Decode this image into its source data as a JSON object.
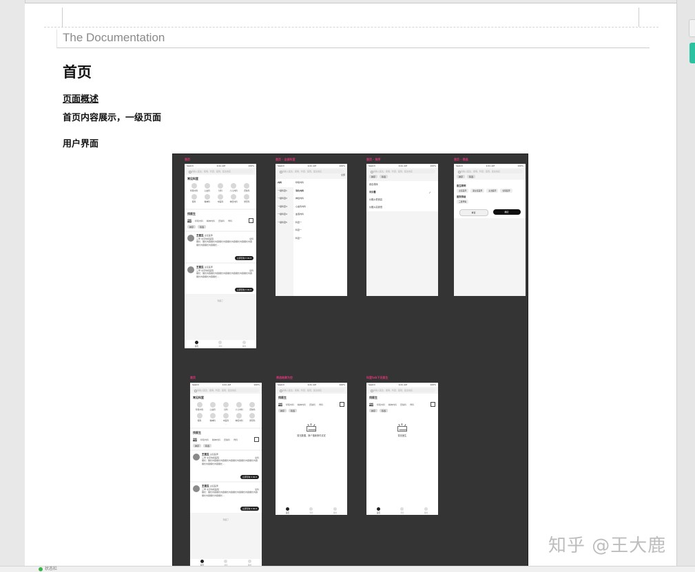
{
  "doc_title": "The Documentation",
  "heading": "首页",
  "section_title": "页面概述",
  "section_desc": "首页内容展示，一级页面",
  "ui_title": "用户界面",
  "watermark": "知乎 @王大鹿",
  "status_text": "状态栏",
  "figure": {
    "labels": [
      "首页",
      "首页 - 全部科室",
      "首页 - 排序",
      "首页 - 筛选",
      "首页",
      "筛选结果为空",
      "科室tab下无医生"
    ],
    "statusbar": {
      "carrier": "Sketch",
      "time": "9:41 AM",
      "battery": "100%"
    },
    "search_placeholder": "请输入医生、疾病、科室、医院、医生姓名",
    "common_depts_title": "常见科室",
    "common_depts": [
      "呼吸内科",
      "心血管",
      "妇科",
      "小儿内科",
      "皮肤科",
      "眼科",
      "精神科",
      "中医科",
      "神经内科",
      "整形科"
    ],
    "more": "···",
    "find_doctor_title": "找医生",
    "tabs": [
      "全科",
      "呼吸内科",
      "精神内科",
      "皮肤科",
      "骨科"
    ],
    "filter_pills": [
      "排序",
      "筛选"
    ],
    "doctors": [
      {
        "name": "王医生",
        "badge": "主任医师",
        "line2": "三甲 北京协和医院",
        "dept": "全科",
        "desc": "擅长：擅长内容擅长内容擅长内容擅长内容擅长内容擅长内容擅长内容擅长内容擅长...",
        "consult": "立即咨询 ¥ 99.8"
      },
      {
        "name": "王医生",
        "badge": "主任医师",
        "line2": "三甲 北京协和医院",
        "dept": "全科",
        "desc": "擅长：擅长内容擅长内容擅长内容擅长内容擅长内容擅长内容擅长内容擅长内容擅长...",
        "consult": "立即咨询 ¥ 99.8"
      }
    ],
    "end_text": "到底了",
    "tabbar": [
      "首页",
      "消息",
      "我的"
    ],
    "all_dept_link": "全部",
    "dept_left": [
      "内科",
      "一级科室1",
      "一级科室2",
      "一级科室3",
      "一级科室4",
      "一级科室5"
    ],
    "dept_right": [
      "呼吸内科",
      "消化内科",
      "神经内科",
      "心血管内科",
      "血液内科",
      "科室一",
      "科室一",
      "科室一"
    ],
    "sort_options": [
      "综合排序",
      "问诊量",
      "价格从低到高",
      "价格从高到低"
    ],
    "filter_sections": [
      {
        "title": "医生职称",
        "chips": [
          "主任医师",
          "副主任医师",
          "主治医师",
          "住院医师"
        ]
      },
      {
        "title": "医院等级",
        "chips": [
          "三级甲等"
        ]
      }
    ],
    "filter_reset": "重置",
    "filter_ok": "确定",
    "empty_filter": "暂无数据，换个搜索条件试试",
    "empty_dept": "暂无医生"
  }
}
